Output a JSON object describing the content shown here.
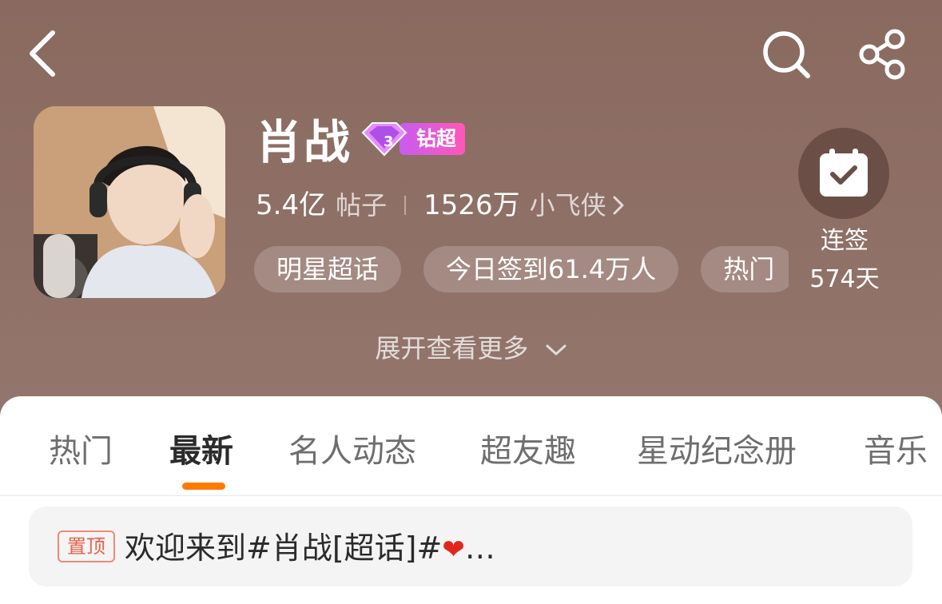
{
  "topbar": {
    "back_icon": "chevron-left-icon",
    "search_icon": "search-icon",
    "share_icon": "share-icon"
  },
  "profile": {
    "name": "肖战",
    "badge_label": "钻超",
    "badge_level": "3",
    "posts_count": "5.4亿",
    "posts_label": "帖子",
    "fans_count": "1526万",
    "fans_label": "小飞侠"
  },
  "tags": [
    "明星超话",
    "今日签到61.4万人",
    "热门"
  ],
  "checkin": {
    "label": "连签",
    "days": "574天"
  },
  "expand_label": "展开查看更多",
  "tabs": [
    "热门",
    "最新",
    "名人动态",
    "超友趣",
    "星动纪念册",
    "音乐"
  ],
  "active_tab": "最新",
  "pinned": {
    "badge": "置顶",
    "text": "欢迎来到#肖战[超话]#",
    "ellipsis": "…"
  },
  "colors": {
    "header_bg": "#8e6f65",
    "tab_indicator": "#ff7a00",
    "badge_gradient_start": "#c85cf0",
    "badge_gradient_end": "#ff57b8"
  }
}
